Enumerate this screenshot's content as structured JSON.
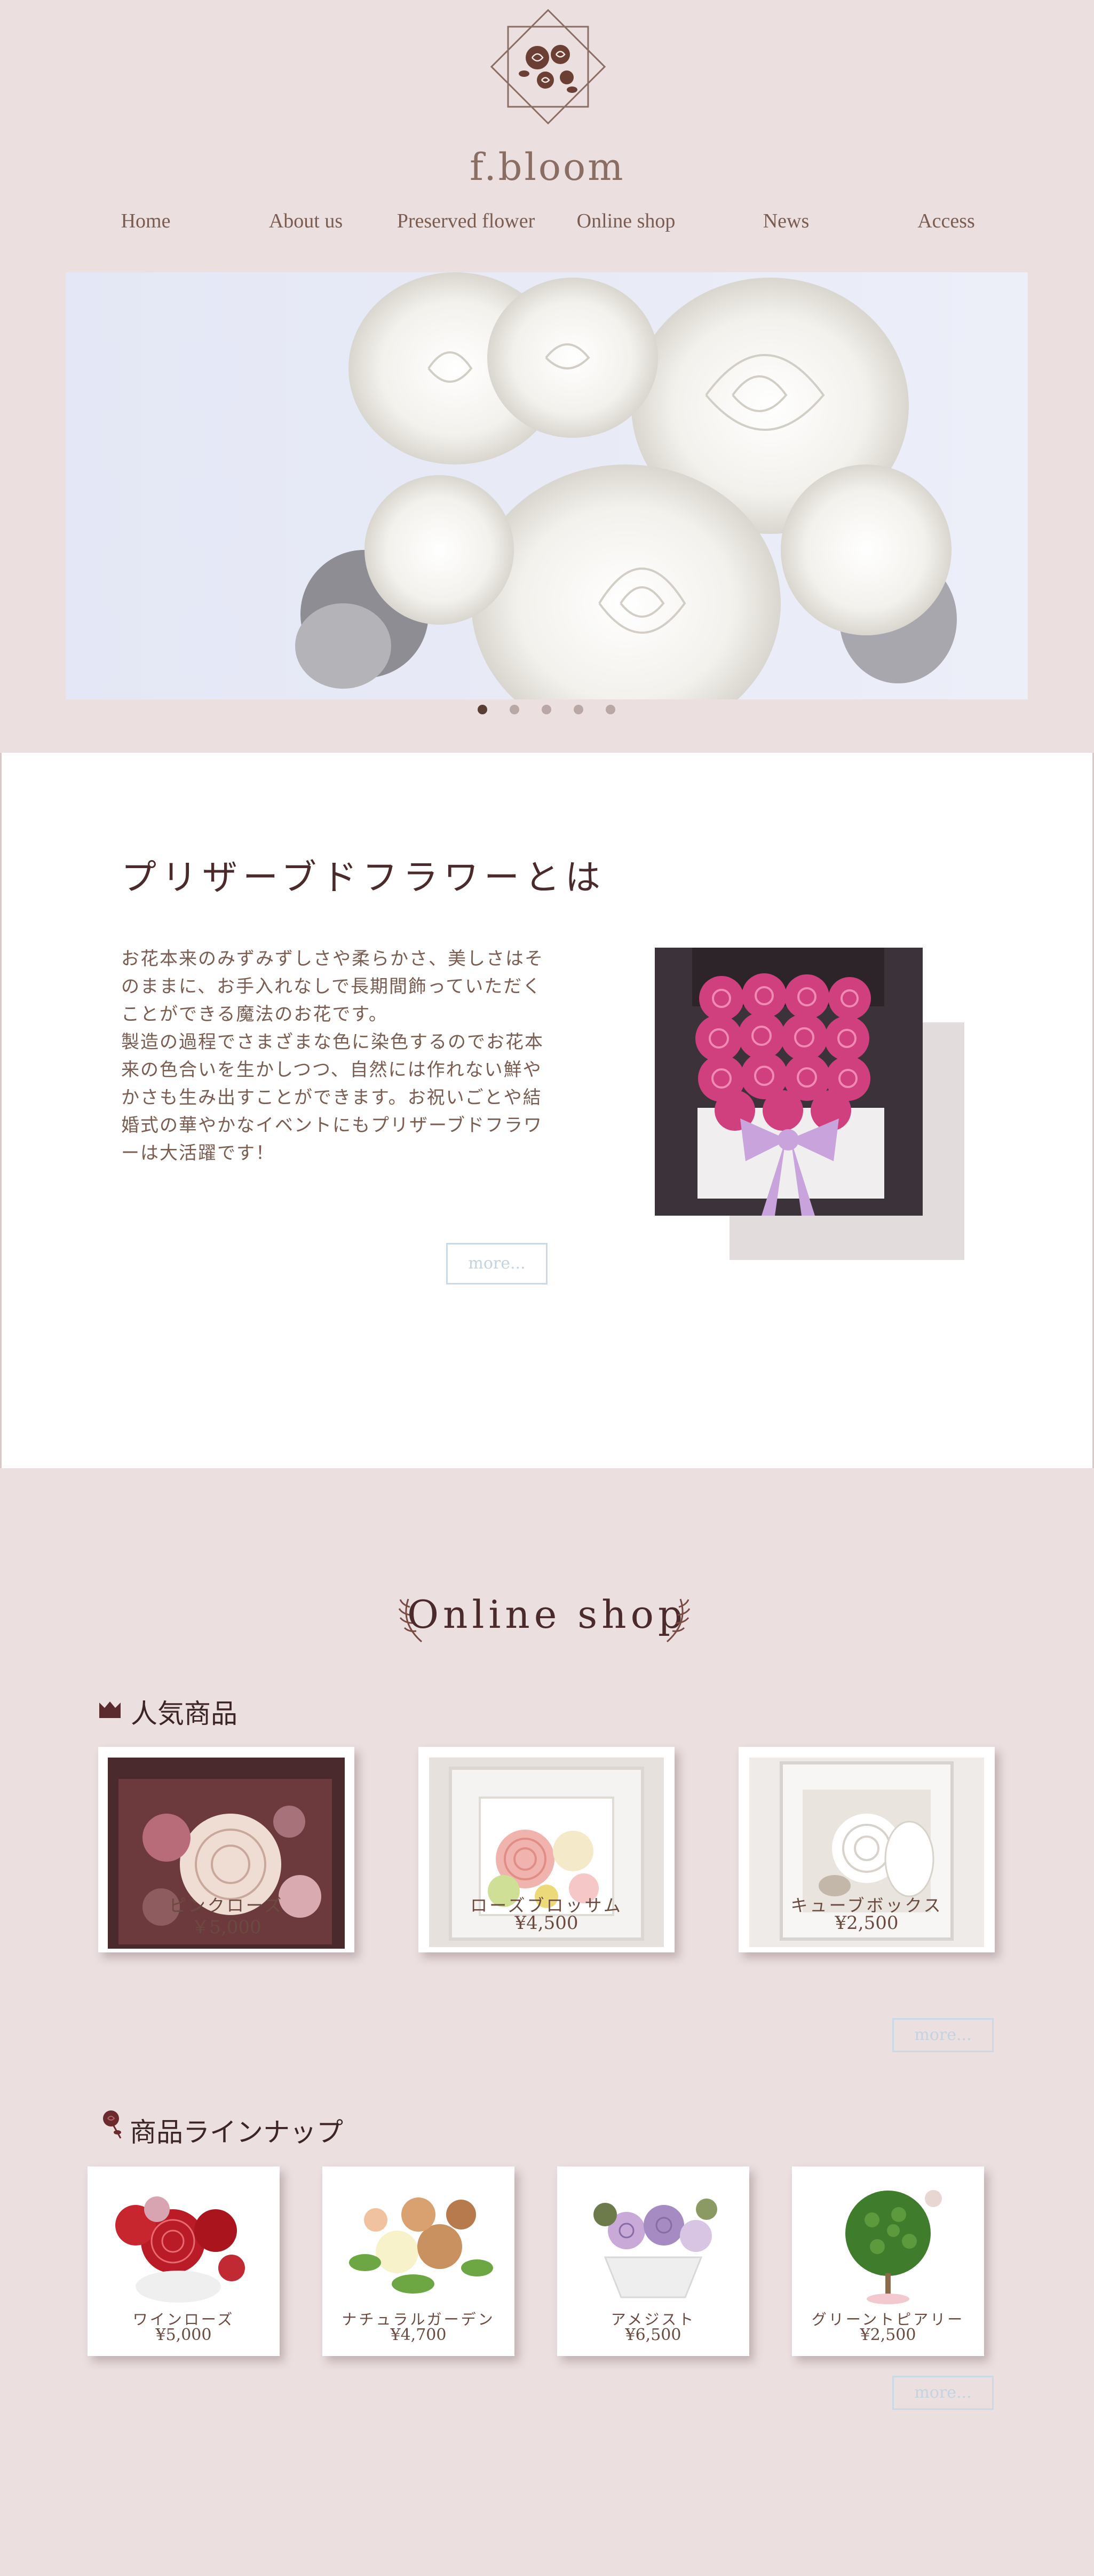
{
  "brand": {
    "logo_text": "f.bloom"
  },
  "nav": {
    "items": [
      {
        "label": "Home"
      },
      {
        "label": "About us"
      },
      {
        "label": "Preserved flower"
      },
      {
        "label": "Online shop"
      },
      {
        "label": "News"
      },
      {
        "label": "Access"
      }
    ]
  },
  "hero": {
    "slide_count": 5,
    "active_slide": 1
  },
  "about": {
    "title": "プリザーブドフラワーとは",
    "lines": [
      "お花本来のみずみずしさや柔らかさ、美しさはそ",
      "のままに、お手入れなしで長期間飾っていただく",
      "ことができる魔法のお花です。",
      "製造の過程でさまざまな色に染色するのでお花本",
      "来の色合いを生かしつつ、自然には作れない鮮や",
      "かさも生み出すことができます。お祝いごとや結",
      "婚式の華やかなイベントにもプリザーブドフラワ",
      "ーは大活躍です！"
    ],
    "more_label": "more..."
  },
  "shop": {
    "title": "Online shop",
    "popular": {
      "heading": "人気商品",
      "more_label": "more...",
      "items": [
        {
          "name": "ピンクローズ",
          "price": "￥5,000"
        },
        {
          "name": "ローズブロッサム",
          "price": "¥4,500"
        },
        {
          "name": "キューブボックス",
          "price": "¥2,500"
        }
      ]
    },
    "lineup": {
      "heading": "商品ラインナップ",
      "more_label": "more...",
      "items": [
        {
          "name": "ワインローズ",
          "price": "¥5,000"
        },
        {
          "name": "ナチュラルガーデン",
          "price": "¥4,700"
        },
        {
          "name": "アメジスト",
          "price": "¥6,500"
        },
        {
          "name": "グリーントピアリー",
          "price": "¥2,500"
        }
      ]
    }
  },
  "colors": {
    "background": "#ebdfe0",
    "accent_dark": "#4a2a2a",
    "text": "#6b4a3f",
    "button_border": "#c9d9e6"
  }
}
